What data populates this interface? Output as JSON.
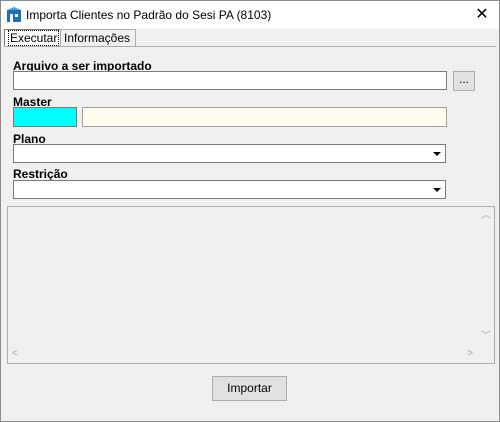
{
  "window": {
    "title": "Importa Clientes no Padrão do Sesi PA (8103)",
    "close_glyph": "✕"
  },
  "tabs": [
    {
      "label": "Executar",
      "active": true
    },
    {
      "label": "Informações",
      "active": false
    }
  ],
  "form": {
    "arquivo_label": "Arquivo a ser importado",
    "arquivo_value": "",
    "browse_label": "...",
    "master_label": "Master",
    "master_code_value": "",
    "master_name_value": "",
    "plano_label": "Plano",
    "plano_value": "",
    "restricao_label": "Restrição",
    "restricao_value": ""
  },
  "log": {
    "text": ""
  },
  "footer": {
    "importar_label": "Importar"
  },
  "colors": {
    "master_code_bg": "#00ffff",
    "master_name_bg": "#fffcf0"
  }
}
